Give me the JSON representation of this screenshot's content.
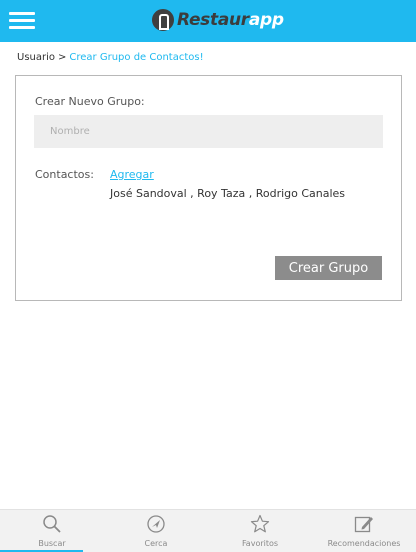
{
  "header": {
    "logo_part1": "Restaur",
    "logo_part2": "app",
    "menu_icon": "hamburger-menu-icon",
    "brand_color": "#1fb9ef"
  },
  "breadcrumb": {
    "parent": "Usuario",
    "separator": ">",
    "current": "Crear Grupo de Contactos!"
  },
  "form": {
    "title": "Crear Nuevo Grupo:",
    "name_placeholder": "Nombre",
    "name_value": "",
    "contacts_label": "Contactos:",
    "add_link": "Agregar",
    "contacts": "José Sandoval , Roy Taza , Rodrigo Canales",
    "submit_label": "Crear Grupo"
  },
  "bottom_nav": {
    "items": [
      {
        "label": "Buscar",
        "icon": "search-icon",
        "active": true
      },
      {
        "label": "Cerca",
        "icon": "navigation-icon",
        "active": false
      },
      {
        "label": "Favoritos",
        "icon": "star-icon",
        "active": false
      },
      {
        "label": "Recomendaciones",
        "icon": "edit-icon",
        "active": false
      }
    ]
  }
}
